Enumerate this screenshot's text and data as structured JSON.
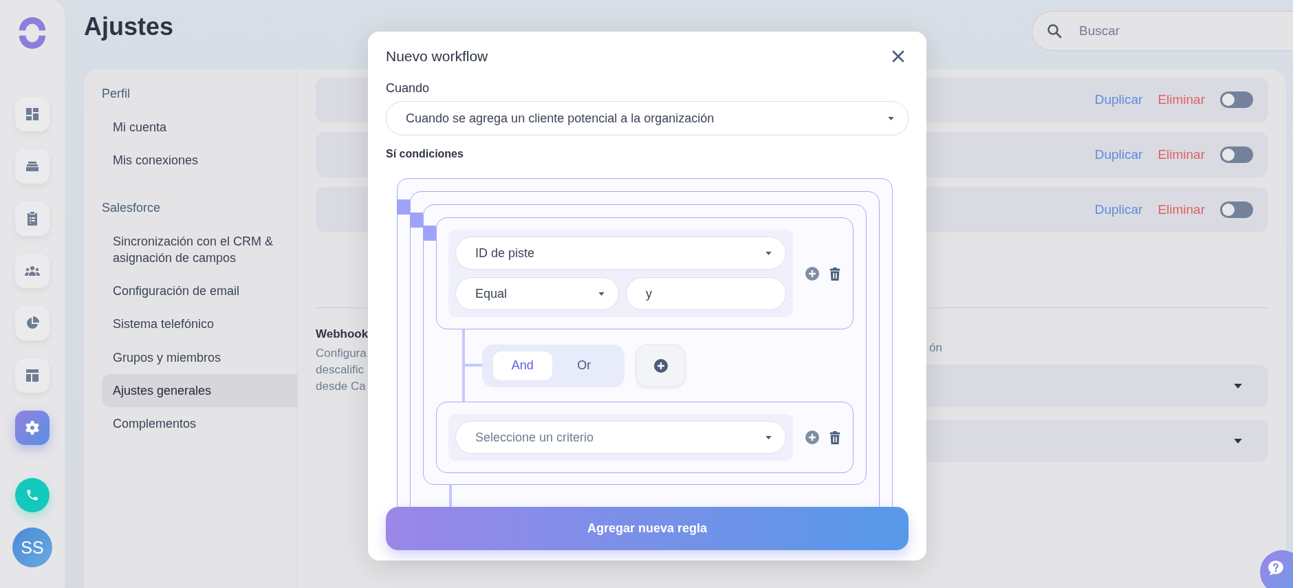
{
  "rail": {
    "items": [
      {
        "kind": "dashboard",
        "selected": false
      },
      {
        "kind": "stack",
        "selected": false
      },
      {
        "kind": "clipboard",
        "selected": false
      },
      {
        "kind": "team",
        "selected": false
      },
      {
        "kind": "pie",
        "selected": false
      },
      {
        "kind": "layout",
        "selected": false
      },
      {
        "kind": "settings",
        "selected": true
      }
    ],
    "avatar": "SS"
  },
  "page": {
    "title": "Ajustes"
  },
  "search": {
    "placeholder": "Buscar"
  },
  "settings_nav": {
    "sections": [
      {
        "heading": "Perfil",
        "items": [
          {
            "label": "Mi cuenta",
            "selected": false
          },
          {
            "label": "Mis conexiones",
            "selected": false
          }
        ]
      },
      {
        "heading": "Salesforce",
        "items": [
          {
            "label": "Sincronización con el CRM & asignación de campos",
            "selected": false
          },
          {
            "label": "Configuración de email",
            "selected": false
          },
          {
            "label": "Sistema telefónico",
            "selected": false
          },
          {
            "label": "Grupos y miembros",
            "selected": false
          },
          {
            "label": "Ajustes generales",
            "selected": true
          },
          {
            "label": "Complementos",
            "selected": false
          }
        ]
      }
    ]
  },
  "workflows": [
    {
      "duplicate": "Duplicar",
      "delete": "Eliminar",
      "on": false
    },
    {
      "duplicate": "Duplicar",
      "delete": "Eliminar",
      "on": false
    },
    {
      "duplicate": "Duplicar",
      "delete": "Eliminar",
      "on": false
    }
  ],
  "webhook": {
    "title": "Webhook",
    "description_lines": [
      "Configura",
      "descalific",
      "desde Ca"
    ],
    "description_tail": "ón"
  },
  "modal": {
    "title": "Nuevo workflow",
    "trigger": {
      "label": "Cuando",
      "value": "Cuando se agrega un cliente potencial a la organización"
    },
    "conditions_label": "Sí condiciones",
    "rules": [
      {
        "kind": "condition",
        "field": "ID de piste",
        "operator": "Equal",
        "value": "y"
      },
      {
        "kind": "empty",
        "placeholder": "Seleccione un criterio"
      }
    ],
    "operators": [
      {
        "label": "And",
        "selected": true
      },
      {
        "label": "Or",
        "selected": false
      }
    ],
    "submit": "Agregar nueva regla"
  }
}
